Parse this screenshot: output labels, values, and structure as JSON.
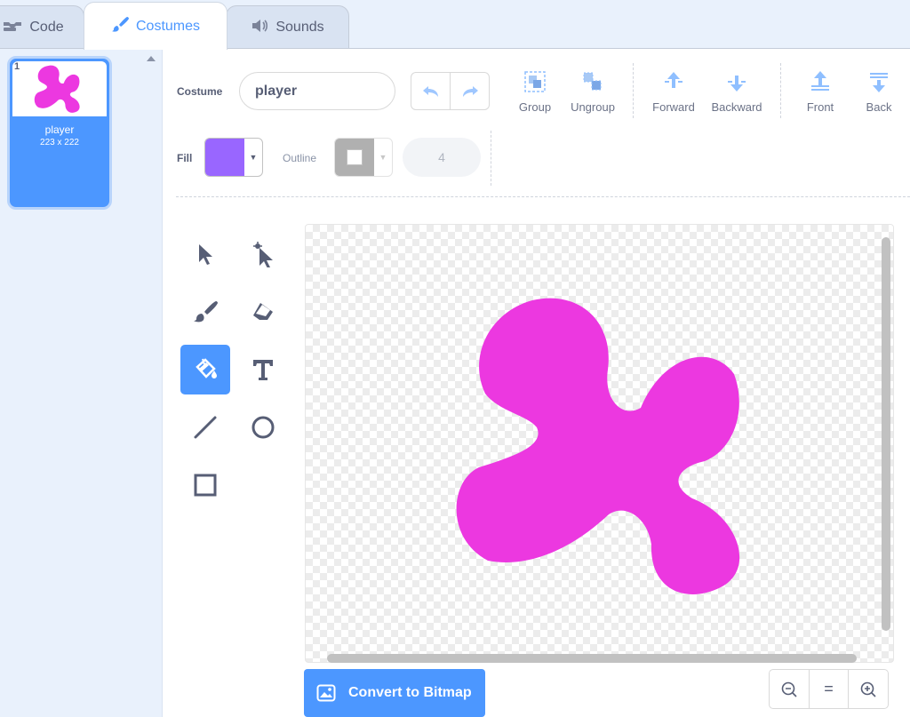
{
  "tabs": {
    "code": "Code",
    "costumes": "Costumes",
    "sounds": "Sounds"
  },
  "costume_list": {
    "items": [
      {
        "number": "1",
        "name": "player",
        "size": "223 x 222"
      }
    ]
  },
  "toolbar": {
    "costume_label": "Costume",
    "costume_name": "player",
    "group": "Group",
    "ungroup": "Ungroup",
    "forward": "Forward",
    "backward": "Backward",
    "front": "Front",
    "back": "Back",
    "fill_label": "Fill",
    "fill_color": "#9966ff",
    "outline_label": "Outline",
    "outline_width": "4"
  },
  "tools": [
    {
      "name": "select",
      "icon": "select-arrow-icon",
      "active": false
    },
    {
      "name": "reshape",
      "icon": "reshape-icon",
      "active": false
    },
    {
      "name": "brush",
      "icon": "brush-icon",
      "active": false
    },
    {
      "name": "eraser",
      "icon": "eraser-icon",
      "active": false
    },
    {
      "name": "fill",
      "icon": "paint-bucket-icon",
      "active": true
    },
    {
      "name": "text",
      "icon": "text-icon",
      "active": false
    },
    {
      "name": "line",
      "icon": "line-icon",
      "active": false
    },
    {
      "name": "circle",
      "icon": "circle-icon",
      "active": false
    },
    {
      "name": "rectangle",
      "icon": "rectangle-icon",
      "active": false
    }
  ],
  "canvas": {
    "shape_color": "#ec38e0"
  },
  "footer": {
    "convert_label": "Convert to Bitmap",
    "zoom_reset": "="
  },
  "colors": {
    "accent": "#4c97ff",
    "text": "#575e75"
  }
}
